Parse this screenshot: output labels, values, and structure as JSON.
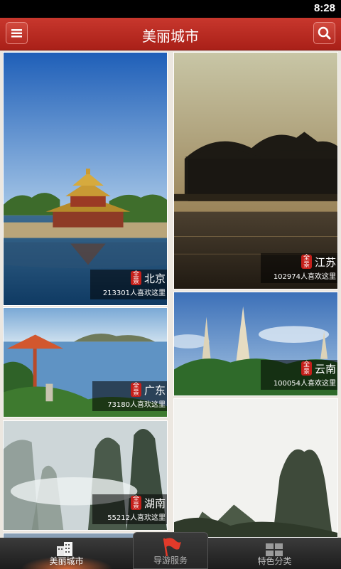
{
  "status": {
    "time": "8:28"
  },
  "header": {
    "title": "美丽城市"
  },
  "seal_text": "全景",
  "cities": [
    {
      "name": "北京",
      "likes": "213301人喜欢这里"
    },
    {
      "name": "江苏",
      "likes": "102974人喜欢这里"
    },
    {
      "name": "广东",
      "likes": "73180人喜欢这里"
    },
    {
      "name": "云南",
      "likes": "100054人喜欢这里"
    },
    {
      "name": "湖南",
      "likes": "55212人喜欢这里"
    }
  ],
  "tabs": [
    {
      "label": "美丽城市",
      "icon": "building-icon"
    },
    {
      "label": "导游服务",
      "icon": "flag-icon"
    },
    {
      "label": "特色分类",
      "icon": "grid-icon"
    }
  ],
  "colors": {
    "titlebar": "#b52a21",
    "seal": "#c41f1a",
    "background": "#ece7e0"
  }
}
